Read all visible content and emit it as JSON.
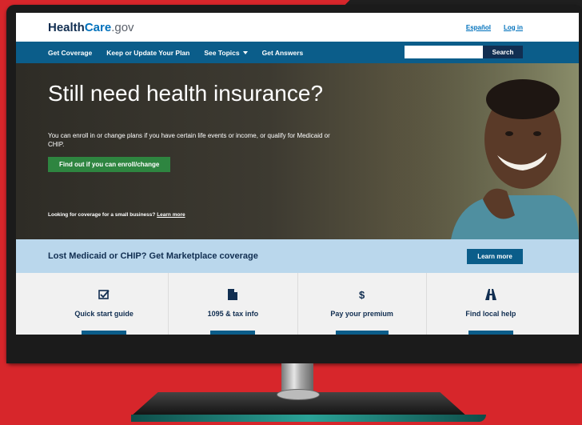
{
  "header": {
    "logo_health": "Health",
    "logo_care": "Care",
    "logo_gov": ".gov",
    "links": [
      "Español",
      "Log in"
    ]
  },
  "nav": {
    "items": [
      "Get Coverage",
      "Keep or Update Your Plan",
      "See Topics",
      "Get Answers"
    ],
    "search_placeholder": "",
    "search_label": "Search"
  },
  "hero": {
    "title": "Still need health insurance?",
    "text": "You can enroll in or change plans if you have certain life events or income, or qualify for Medicaid or CHIP.",
    "button": "Find out if you can enroll/change",
    "small_text": "Looking for coverage for a small business?",
    "small_link": "Learn more"
  },
  "banner": {
    "title": "Lost Medicaid or CHIP? Get Marketplace coverage",
    "button": "Learn more"
  },
  "cards": [
    {
      "icon": "checklist-icon",
      "label": "Quick start guide"
    },
    {
      "icon": "document-icon",
      "label": "1095 & tax info"
    },
    {
      "icon": "dollar-icon",
      "label": "Pay your premium"
    },
    {
      "icon": "road-icon",
      "label": "Find local help"
    }
  ],
  "colors": {
    "background": "#d7262b",
    "nav": "#0b5d8a",
    "primary_text": "#112e51",
    "green_button": "#2e8540",
    "banner": "#bad7ec"
  }
}
